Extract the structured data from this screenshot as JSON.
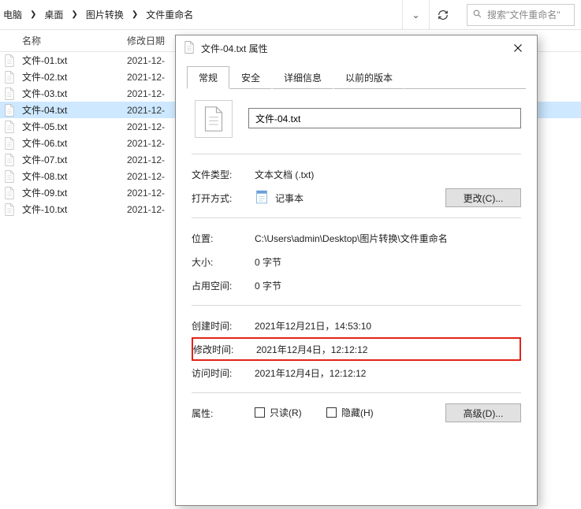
{
  "breadcrumb": {
    "parts": [
      "电脑",
      "桌面",
      "图片转换",
      "文件重命名"
    ]
  },
  "search": {
    "placeholder": "搜索\"文件重命名\""
  },
  "columns": {
    "name": "名称",
    "modified": "修改日期"
  },
  "files": [
    {
      "name": "文件-01.txt",
      "date": "2021-12-"
    },
    {
      "name": "文件-02.txt",
      "date": "2021-12-"
    },
    {
      "name": "文件-03.txt",
      "date": "2021-12-"
    },
    {
      "name": "文件-04.txt",
      "date": "2021-12-",
      "selected": true
    },
    {
      "name": "文件-05.txt",
      "date": "2021-12-"
    },
    {
      "name": "文件-06.txt",
      "date": "2021-12-"
    },
    {
      "name": "文件-07.txt",
      "date": "2021-12-"
    },
    {
      "name": "文件-08.txt",
      "date": "2021-12-"
    },
    {
      "name": "文件-09.txt",
      "date": "2021-12-"
    },
    {
      "name": "文件-10.txt",
      "date": "2021-12-"
    }
  ],
  "dialog": {
    "title": "文件-04.txt 属性",
    "tabs": {
      "general": "常规",
      "security": "安全",
      "details": "详细信息",
      "previous": "以前的版本"
    },
    "filename": "文件-04.txt",
    "labels": {
      "filetype": "文件类型:",
      "openwith": "打开方式:",
      "location": "位置:",
      "size": "大小:",
      "sizeondisk": "占用空间:",
      "created": "创建时间:",
      "modified": "修改时间:",
      "accessed": "访问时间:",
      "attributes": "属性:"
    },
    "values": {
      "filetype": "文本文档 (.txt)",
      "openwith_app": "记事本",
      "location": "C:\\Users\\admin\\Desktop\\图片转换\\文件重命名",
      "size": "0 字节",
      "sizeondisk": "0 字节",
      "created": "2021年12月21日，14:53:10",
      "modified": "2021年12月4日，12:12:12",
      "accessed": "2021年12月4日，12:12:12"
    },
    "buttons": {
      "change": "更改(C)...",
      "advanced": "高级(D)..."
    },
    "checkboxes": {
      "readonly": "只读(R)",
      "hidden": "隐藏(H)"
    }
  }
}
